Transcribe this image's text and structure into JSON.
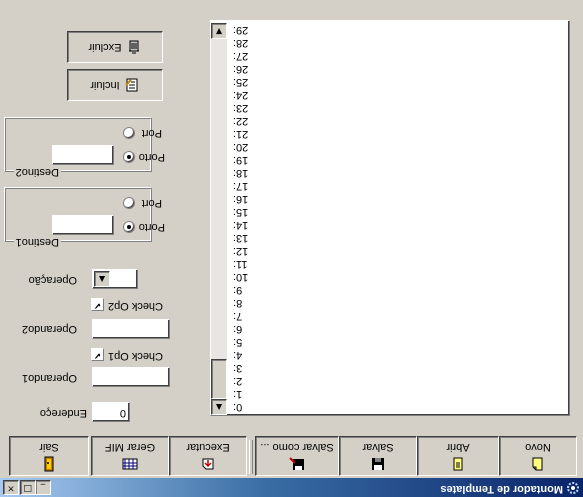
{
  "window": {
    "title": "Montador de Templates",
    "controls": {
      "minimize": "_",
      "maximize": "□",
      "close": "×"
    }
  },
  "toolbar": {
    "buttons": [
      {
        "label": "Novo",
        "icon": "new-doc-icon"
      },
      {
        "label": "Abrir",
        "icon": "open-doc-icon"
      },
      {
        "label": "Salvar",
        "icon": "floppy-icon"
      },
      {
        "label": "Salvar como ...",
        "icon": "save-as-icon"
      },
      {
        "label": "Executar",
        "icon": "execute-icon"
      },
      {
        "label": "Gerar MIF",
        "icon": "grid-icon"
      },
      {
        "label": "Sair",
        "icon": "exit-door-icon"
      }
    ]
  },
  "list": {
    "items": [
      "0:",
      "1:",
      "2:",
      "3:",
      "4:",
      "5:",
      "6:",
      "7:",
      "8:",
      "9:",
      "10:",
      "11:",
      "12:",
      "13:",
      "14:",
      "15:",
      "16:",
      "17:",
      "18:",
      "19:",
      "20:",
      "21:",
      "22:",
      "23:",
      "24:",
      "25:",
      "26:",
      "27:",
      "28:",
      "29:"
    ]
  },
  "form": {
    "endereco": {
      "label": "Endereço",
      "value": "0"
    },
    "operando1": {
      "label": "Operando1",
      "value": ""
    },
    "check_op1": {
      "label": "Check Op1",
      "checked": true
    },
    "operando2": {
      "label": "Operando2",
      "value": ""
    },
    "check_op2": {
      "label": "Check Op2",
      "checked": true
    },
    "operacao": {
      "label": "Operação",
      "value": ""
    },
    "destino1": {
      "label": "Destino1",
      "options": [
        "Porto",
        "Port"
      ],
      "selected": "Porto",
      "value": ""
    },
    "destino2": {
      "label": "Destino2",
      "options": [
        "Porto",
        "Port"
      ],
      "selected": "Porto",
      "value": ""
    }
  },
  "actions": {
    "incluir": "Incluir",
    "excluir": "Excluir"
  }
}
